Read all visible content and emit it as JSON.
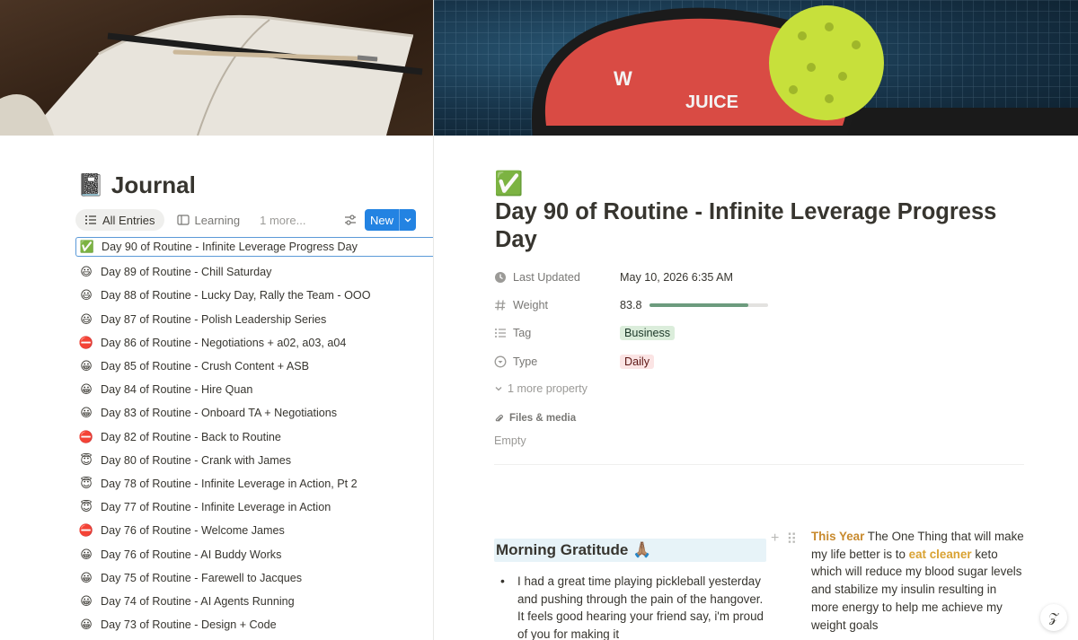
{
  "sidebar": {
    "db_icon": "📓",
    "db_title": "Journal",
    "tabs": [
      {
        "label": "All Entries"
      },
      {
        "label": "Learning"
      }
    ],
    "more_tabs": "1 more...",
    "new_label": "New",
    "entries": [
      {
        "emoji": "✅",
        "title": "Day 90 of Routine - Infinite Leverage Progress Day"
      },
      {
        "emoji": "😃",
        "title": "Day 89 of Routine - Chill Saturday"
      },
      {
        "emoji": "😃",
        "title": "Day 88 of Routine - Lucky Day, Rally the Team - OOO"
      },
      {
        "emoji": "😃",
        "title": "Day 87 of Routine - Polish Leadership Series"
      },
      {
        "emoji": "⛔",
        "title": "Day 86 of Routine - Negotiations + a02, a03, a04"
      },
      {
        "emoji": "😀",
        "title": "Day 85 of Routine - Crush Content + ASB"
      },
      {
        "emoji": "😀",
        "title": "Day 84 of Routine - Hire Quan"
      },
      {
        "emoji": "😀",
        "title": "Day 83 of Routine - Onboard TA + Negotiations"
      },
      {
        "emoji": "⛔",
        "title": "Day 82 of Routine - Back to Routine"
      },
      {
        "emoji": "😇",
        "title": "Day 80 of Routine - Crank with James"
      },
      {
        "emoji": "😇",
        "title": "Day 78 of Routine - Infinite Leverage in Action, Pt 2"
      },
      {
        "emoji": "😇",
        "title": "Day 77 of Routine - Infinite Leverage in Action"
      },
      {
        "emoji": "⛔",
        "title": "Day 76 of Routine - Welcome James"
      },
      {
        "emoji": "😀",
        "title": "Day 76 of Routine - AI Buddy Works"
      },
      {
        "emoji": "😀",
        "title": "Day 75 of Routine - Farewell to Jacques"
      },
      {
        "emoji": "😀",
        "title": "Day 74 of Routine - AI Agents Running"
      },
      {
        "emoji": "😀",
        "title": "Day 73 of Routine - Design + Code"
      }
    ]
  },
  "page": {
    "icon": "✅",
    "title": "Day 90 of Routine - Infinite Leverage Progress Day",
    "properties": {
      "last_updated": {
        "name": "Last Updated",
        "value": "May 10, 2026 6:35 AM"
      },
      "weight": {
        "name": "Weight",
        "value": "83.8",
        "progress": 0.838
      },
      "tag": {
        "name": "Tag",
        "value": "Business"
      },
      "type": {
        "name": "Type",
        "value": "Daily"
      }
    },
    "more_properties": "1 more property",
    "files_label": "Files & media",
    "files_value": "Empty",
    "gratitude_heading": "Morning Gratitude 🙏🏽",
    "gratitude_bullet": "I had a great time playing pickleball yesterday and pushing through the pain of the hangover.  It feels good hearing your friend say, i'm proud of you for making it",
    "one_thing": {
      "prefix": "This Year",
      "middle": " The One Thing  that will make my life better is to ",
      "highlight": "eat cleaner",
      "suffix": " keto which will reduce my blood sugar levels and stabilize my insulin resulting in more energy to help me achieve my weight goals"
    }
  },
  "colors": {
    "accent_blue": "#2383e2",
    "tag_business_bg": "#dbeddb",
    "tag_daily_bg": "#fbe4e4",
    "heading_bg": "#e7f3f8",
    "text_orange": "#c88a2e"
  }
}
